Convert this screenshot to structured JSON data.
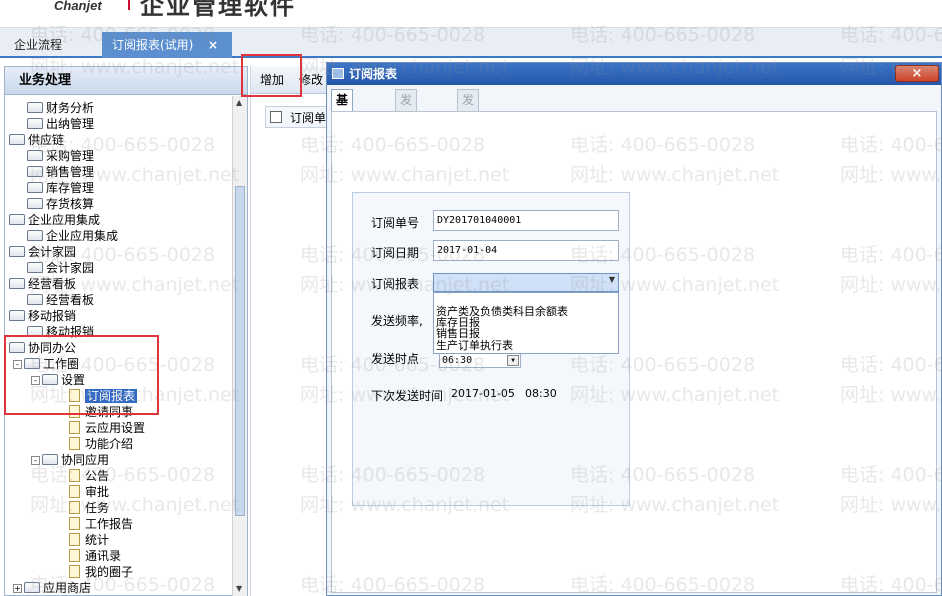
{
  "header": {
    "logo": "Chanjet",
    "brand": "企业管理软件"
  },
  "tabs": [
    {
      "label": "企业流程"
    },
    {
      "label": "订阅报表(试用)",
      "close": "×"
    }
  ],
  "left_panel": {
    "title": "业务处理",
    "tree": [
      {
        "label": "财务分析",
        "level": 2,
        "icon": "folder-icon"
      },
      {
        "label": "出纳管理",
        "level": 2,
        "icon": "folder-icon"
      },
      {
        "label": "供应链",
        "level": 0,
        "icon": "folder-open-icon"
      },
      {
        "label": "采购管理",
        "level": 2,
        "icon": "folder-icon"
      },
      {
        "label": "销售管理",
        "level": 2,
        "icon": "folder-icon"
      },
      {
        "label": "库存管理",
        "level": 2,
        "icon": "folder-icon"
      },
      {
        "label": "存货核算",
        "level": 2,
        "icon": "folder-icon"
      },
      {
        "label": "企业应用集成",
        "level": 0,
        "icon": "folder-open-icon"
      },
      {
        "label": "企业应用集成",
        "level": 2,
        "icon": "folder-icon"
      },
      {
        "label": "会计家园",
        "level": 0,
        "icon": "folder-open-icon"
      },
      {
        "label": "会计家园",
        "level": 2,
        "icon": "folder-icon"
      },
      {
        "label": "经营看板",
        "level": 0,
        "icon": "folder-open-icon"
      },
      {
        "label": "经营看板",
        "level": 2,
        "icon": "folder-icon"
      },
      {
        "label": "移动报销",
        "level": 0,
        "icon": "folder-open-icon"
      },
      {
        "label": "移动报销",
        "level": 2,
        "icon": "folder-icon"
      },
      {
        "label": "协同办公",
        "level": 0,
        "icon": "folder-open-icon"
      },
      {
        "label": "工作圈",
        "level": 1,
        "icon": "folder-open-icon",
        "toggle": "-"
      },
      {
        "label": "设置",
        "level": 2,
        "icon": "folder-open-icon",
        "toggle": "-"
      },
      {
        "label": "订阅报表",
        "level": 3,
        "icon": "document-icon",
        "selected": true
      },
      {
        "label": "邀请同事",
        "level": 3,
        "icon": "document-icon"
      },
      {
        "label": "云应用设置",
        "level": 3,
        "icon": "document-icon"
      },
      {
        "label": "功能介绍",
        "level": 3,
        "icon": "document-icon"
      },
      {
        "label": "协同应用",
        "level": 2,
        "icon": "folder-open-icon",
        "toggle": "-"
      },
      {
        "label": "公告",
        "level": 3,
        "icon": "document-icon"
      },
      {
        "label": "审批",
        "level": 3,
        "icon": "document-icon"
      },
      {
        "label": "任务",
        "level": 3,
        "icon": "document-icon"
      },
      {
        "label": "工作报告",
        "level": 3,
        "icon": "document-icon"
      },
      {
        "label": "统计",
        "level": 3,
        "icon": "document-icon"
      },
      {
        "label": "通讯录",
        "level": 3,
        "icon": "document-icon"
      },
      {
        "label": "我的圈子",
        "level": 3,
        "icon": "document-icon"
      },
      {
        "label": "应用商店",
        "level": 1,
        "icon": "folder-icon",
        "toggle": "+"
      }
    ]
  },
  "toolbar": {
    "add": "增加",
    "edit": "修改"
  },
  "grid": {
    "col1": "订阅单"
  },
  "dialog": {
    "title": "订阅报表",
    "close": "×",
    "tabs": [
      "基本信息",
      "发送条件",
      "发送对象"
    ],
    "form": {
      "order_no_label": "订阅单号",
      "order_no": "DY201701040001",
      "date_label": "订阅日期",
      "date": "2017-01-04",
      "report_label": "订阅报表",
      "report_options": [
        "资产类及负债类科目余额表",
        "库存日报",
        "销售日报",
        "生产订单执行表"
      ],
      "freq_label": "发送频率,",
      "time_label": "发送时点",
      "time": "06:30",
      "next_label": "下次发送时间",
      "next_date": "2017-01-05",
      "next_time": "08:30"
    }
  },
  "watermark": {
    "phone": "电话: 400-665-0028",
    "site": "网址: www.chanjet.net"
  }
}
